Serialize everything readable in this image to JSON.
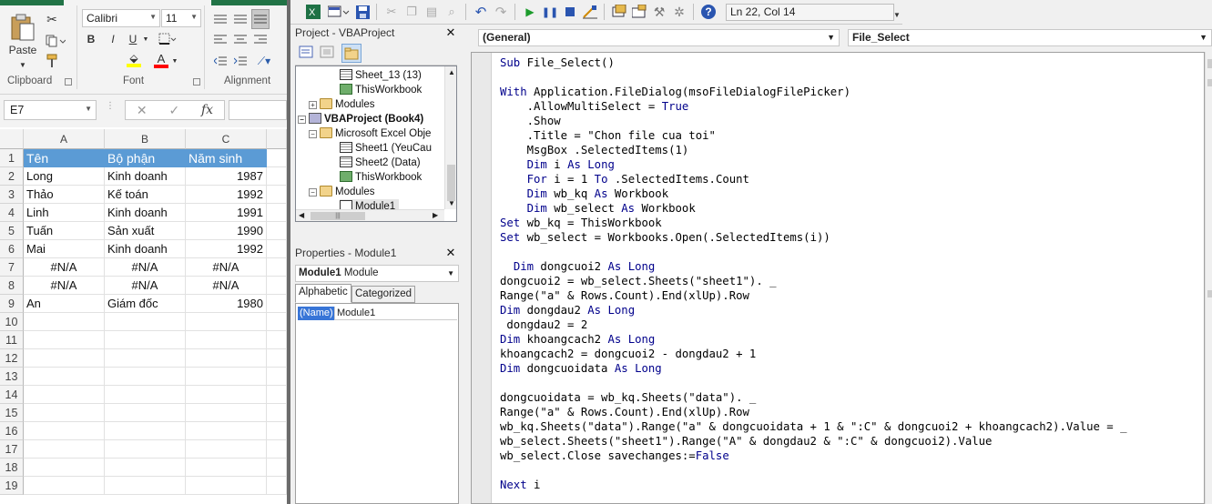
{
  "excel": {
    "clipboard": {
      "paste_label": "Paste",
      "group_label": "Clipboard"
    },
    "font": {
      "name": "Calibri",
      "size": "11",
      "group_label": "Font",
      "bold": "B",
      "italic": "I",
      "underline": "U",
      "grow": "A",
      "shrink": "A",
      "font_color_glyph": "A"
    },
    "alignment": {
      "group_label": "Alignment"
    },
    "formula_bar": {
      "name_box": "E7",
      "cancel": "✕",
      "enter": "✓",
      "fx": "fx"
    },
    "columns": [
      "A",
      "B",
      "C"
    ],
    "rows": [
      "1",
      "2",
      "3",
      "4",
      "5",
      "6",
      "7",
      "8",
      "9",
      "10",
      "11",
      "12",
      "13",
      "14",
      "15",
      "16",
      "17",
      "18",
      "19"
    ],
    "table": {
      "header": [
        "Tên",
        "Bộ phận",
        "Năm sinh"
      ],
      "data": [
        [
          "Long",
          "Kinh doanh",
          "1987"
        ],
        [
          "Thảo",
          "Kế toán",
          "1992"
        ],
        [
          "Linh",
          "Kinh doanh",
          "1991"
        ],
        [
          "Tuấn",
          "Sản xuất",
          "1990"
        ],
        [
          "Mai",
          "Kinh doanh",
          "1992"
        ],
        [
          "#N/A",
          "#N/A",
          "#N/A"
        ],
        [
          "#N/A",
          "#N/A",
          "#N/A"
        ],
        [
          "An",
          "Giám đốc",
          "1980"
        ]
      ]
    },
    "colors": {
      "header_fill": "#5b9bd5",
      "ribbon_green": "#217346"
    }
  },
  "vbe": {
    "toolbar": {
      "cursor_position": "Ln 22, Col 14"
    },
    "project": {
      "title": "Project - VBAProject",
      "close": "✕",
      "tree": [
        "Sheet_13 (13)",
        "ThisWorkbook",
        "Modules",
        "VBAProject (Book4)",
        "Microsoft Excel Obje",
        "Sheet1 (YeuCau",
        "Sheet2 (Data)",
        "ThisWorkbook",
        "Modules",
        "Module1"
      ]
    },
    "properties": {
      "title": "Properties - Module1",
      "close": "✕",
      "object_name": "Module1",
      "object_type": "Module",
      "tabs": [
        "Alphabetic",
        "Categorized"
      ],
      "rows": [
        {
          "name": "(Name)",
          "value": "Module1"
        }
      ]
    },
    "code": {
      "object_combo": "(General)",
      "proc_combo": "File_Select",
      "lines": [
        "Sub File_Select()",
        "",
        "With Application.FileDialog(msoFileDialogFilePicker)",
        "    .AllowMultiSelect = True",
        "    .Show",
        "    .Title = \"Chon file cua toi\"",
        "    MsgBox .SelectedItems(1)",
        "    Dim i As Long",
        "    For i = 1 To .SelectedItems.Count",
        "    Dim wb_kq As Workbook",
        "    Dim wb_select As Workbook",
        "Set wb_kq = ThisWorkbook",
        "Set wb_select = Workbooks.Open(.SelectedItems(i))",
        "",
        "  Dim dongcuoi2 As Long",
        "dongcuoi2 = wb_select.Sheets(\"sheet1\"). _",
        "Range(\"a\" & Rows.Count).End(xlUp).Row",
        "Dim dongdau2 As Long",
        " dongdau2 = 2",
        "Dim khoangcach2 As Long",
        "khoangcach2 = dongcuoi2 - dongdau2 + 1",
        "Dim dongcuoidata As Long",
        "",
        "dongcuoidata = wb_kq.Sheets(\"data\"). _",
        "Range(\"a\" & Rows.Count).End(xlUp).Row",
        "wb_kq.Sheets(\"data\").Range(\"a\" & dongcuoidata + 1 & \":C\" & dongcuoi2 + khoangcach2).Value = _",
        "wb_select.Sheets(\"sheet1\").Range(\"A\" & dongdau2 & \":C\" & dongcuoi2).Value",
        "wb_select.Close savechanges:=False",
        "",
        "Next i"
      ]
    }
  }
}
